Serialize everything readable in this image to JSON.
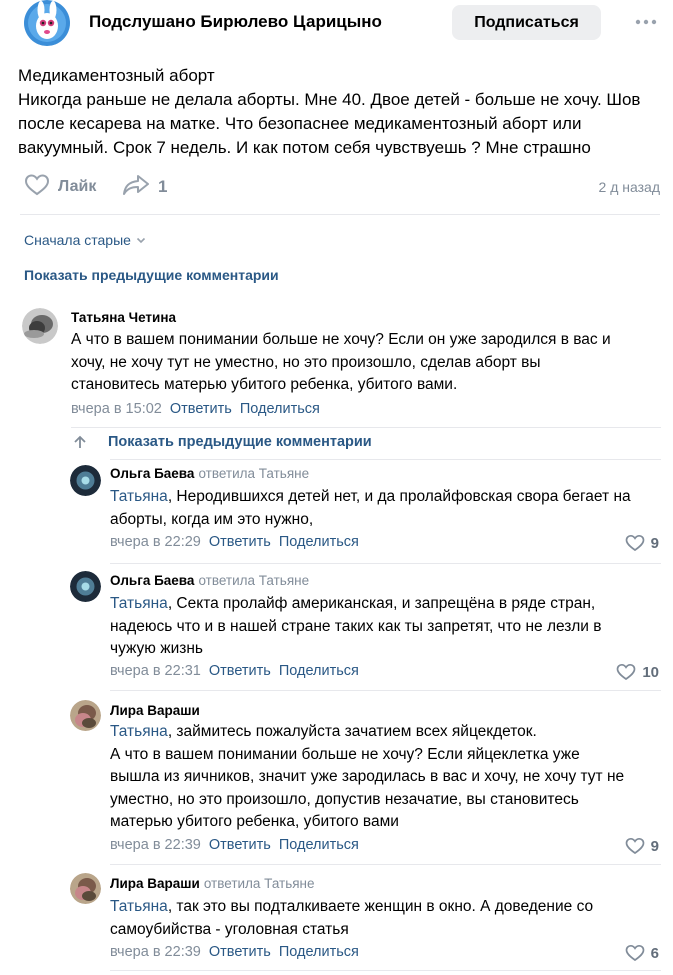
{
  "header": {
    "group_name": "Подслушано Бирюлево Царицыно",
    "subscribe_label": "Подписаться"
  },
  "post": {
    "lines": [
      "Медикаментозный аборт",
      "Никогда раньше не делала аборты. Мне 40. Двое детей - больше не хочу. Шов",
      "после кесарева на матке. Что безопаснее медикаментозный аборт или",
      "вакуумный. Срок 7 недель. И как потом себя чувствуешь ? Мне страшно"
    ],
    "like_label": "Лайк",
    "share_count": "1",
    "time": "2 д назад"
  },
  "comments_controls": {
    "sort_label": "Сначала старые",
    "show_previous": "Показать предыдущие комментарии"
  },
  "comment_main": {
    "author": "Татьяна Четина",
    "lines": [
      "А что в вашем понимании больше не хочу? Если он уже зародился в вас и",
      "хочу, не хочу тут не уместно, но это произошло, сделав аборт вы",
      "становитесь матерью убитого ребенка, убитого вами."
    ],
    "time": "вчера в 15:02",
    "reply": "Ответить",
    "share": "Поделиться"
  },
  "thread_show_previous": "Показать предыдущие комментарии",
  "replies": [
    {
      "author": "Ольга Баева",
      "replied_to": "ответила Татьяне",
      "mention": "Татьяна",
      "lines": [
        ", Неродившихся детей нет, и да пролайфовская свора бегает на",
        "аборты, когда им это нужно,"
      ],
      "time": "вчера в 22:29",
      "reply": "Ответить",
      "share": "Поделиться",
      "likes": "9"
    },
    {
      "author": "Ольга Баева",
      "replied_to": "ответила Татьяне",
      "mention": "Татьяна",
      "lines": [
        ", Секта пролайф американская, и запрещёна в ряде стран,",
        "надеюсь что и в нашей стране таких как ты запретят, что не лезли в",
        "чужую жизнь"
      ],
      "time": "вчера в 22:31",
      "reply": "Ответить",
      "share": "Поделиться",
      "likes": "10"
    },
    {
      "author": "Лира Вараши",
      "replied_to": "",
      "mention": "Татьяна",
      "lines": [
        ", займитесь пожалуйста зачатием всех яйцекдеток.",
        "А что в вашем понимании больше не хочу? Если яйцеклетка уже",
        "вышла из яичников, значит уже зародилась в вас и хочу, не хочу тут не",
        "уместно, но это произошло, допустив незачатие, вы становитесь",
        "матерью убитого ребенка, убитого вами"
      ],
      "time": "вчера в 22:39",
      "reply": "Ответить",
      "share": "Поделиться",
      "likes": "9"
    },
    {
      "author": "Лира Вараши",
      "replied_to": "ответила Татьяне",
      "mention": "Татьяна",
      "lines": [
        ", так это вы подталкиваете женщин в окно. А доведение со",
        "самоубийства - уголовная статья"
      ],
      "time": "вчера в 22:39",
      "reply": "Ответить",
      "share": "Поделиться",
      "likes": "6"
    }
  ],
  "colors": {
    "link": "#2a5885",
    "secondary": "#818c99",
    "button_bg": "#edeef0",
    "divider": "#e7e8ec"
  }
}
